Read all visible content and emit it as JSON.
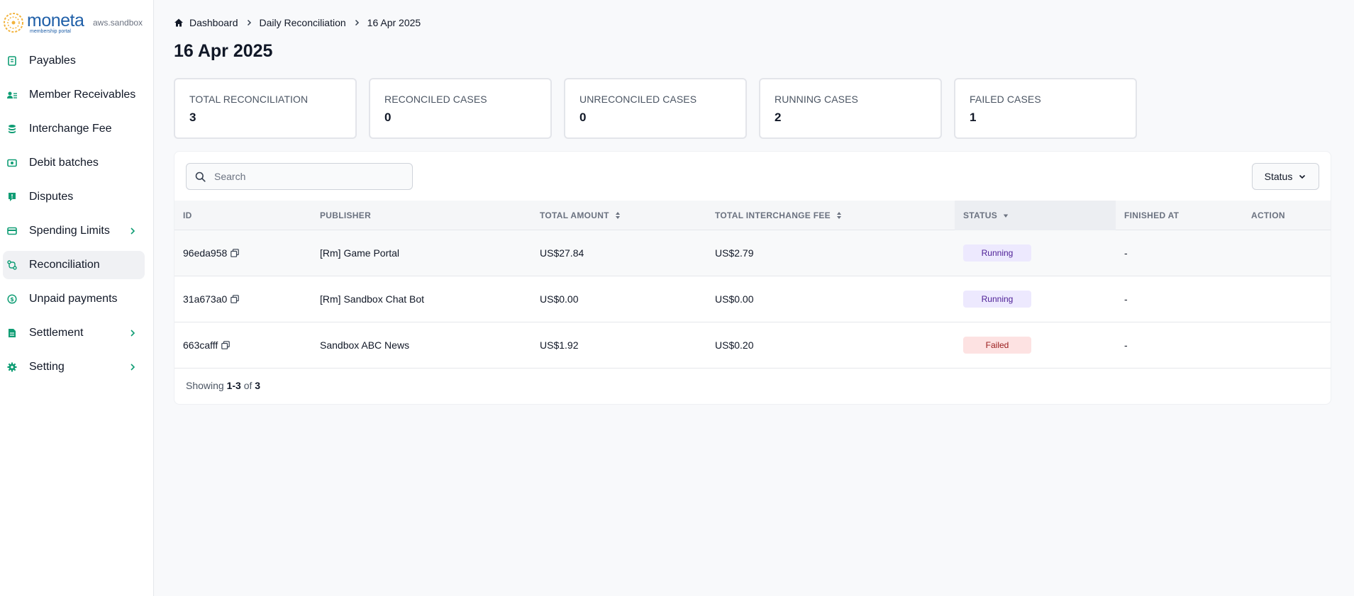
{
  "brand": {
    "name": "moneta",
    "subtitle": "membership portal",
    "env": "aws.sandbox"
  },
  "colors": {
    "accent": "#0f9d74",
    "brand": "#1f5fa8",
    "running_bg": "#ede9fe",
    "failed_bg": "#fde2e2"
  },
  "sidebar": {
    "items": [
      {
        "label": "Payables",
        "icon": "payables-icon",
        "chevron": false,
        "active": false
      },
      {
        "label": "Member Receivables",
        "icon": "member-receivables-icon",
        "chevron": false,
        "active": false
      },
      {
        "label": "Interchange Fee",
        "icon": "database-icon",
        "chevron": false,
        "active": false
      },
      {
        "label": "Debit batches",
        "icon": "cash-icon",
        "chevron": false,
        "active": false
      },
      {
        "label": "Disputes",
        "icon": "alert-message-icon",
        "chevron": false,
        "active": false
      },
      {
        "label": "Spending Limits",
        "icon": "credit-card-icon",
        "chevron": true,
        "active": false
      },
      {
        "label": "Reconciliation",
        "icon": "reconcile-icon",
        "chevron": false,
        "active": true
      },
      {
        "label": "Unpaid payments",
        "icon": "dollar-circle-icon",
        "chevron": false,
        "active": false
      },
      {
        "label": "Settlement",
        "icon": "document-icon",
        "chevron": true,
        "active": false
      },
      {
        "label": "Setting",
        "icon": "gear-icon",
        "chevron": true,
        "active": false
      }
    ]
  },
  "breadcrumb": {
    "home": "Dashboard",
    "parent": "Daily Reconciliation",
    "current": "16 Apr 2025"
  },
  "page": {
    "title": "16 Apr 2025"
  },
  "stats": [
    {
      "label": "TOTAL RECONCILIATION",
      "value": "3"
    },
    {
      "label": "RECONCILED CASES",
      "value": "0"
    },
    {
      "label": "UNRECONCILED CASES",
      "value": "0"
    },
    {
      "label": "RUNNING CASES",
      "value": "2"
    },
    {
      "label": "FAILED CASES",
      "value": "1"
    }
  ],
  "search": {
    "placeholder": "Search",
    "value": ""
  },
  "filter": {
    "status_label": "Status"
  },
  "table": {
    "headers": {
      "id": "ID",
      "publisher": "PUBLISHER",
      "total_amount": "TOTAL AMOUNT",
      "total_fee": "TOTAL INTERCHANGE FEE",
      "status": "STATUS",
      "finished_at": "FINISHED AT",
      "action": "ACTION"
    },
    "rows": [
      {
        "id": "96eda958",
        "publisher": "[Rm] Game Portal",
        "total_amount": "US$27.84",
        "total_fee": "US$2.79",
        "status": "Running",
        "finished_at": "-"
      },
      {
        "id": "31a673a0",
        "publisher": "[Rm] Sandbox Chat Bot",
        "total_amount": "US$0.00",
        "total_fee": "US$0.00",
        "status": "Running",
        "finished_at": "-"
      },
      {
        "id": "663cafff",
        "publisher": "Sandbox ABC News",
        "total_amount": "US$1.92",
        "total_fee": "US$0.20",
        "status": "Failed",
        "finished_at": "-"
      }
    ]
  },
  "pagination": {
    "prefix": "Showing",
    "range": "1-3",
    "of": "of",
    "total": "3"
  }
}
